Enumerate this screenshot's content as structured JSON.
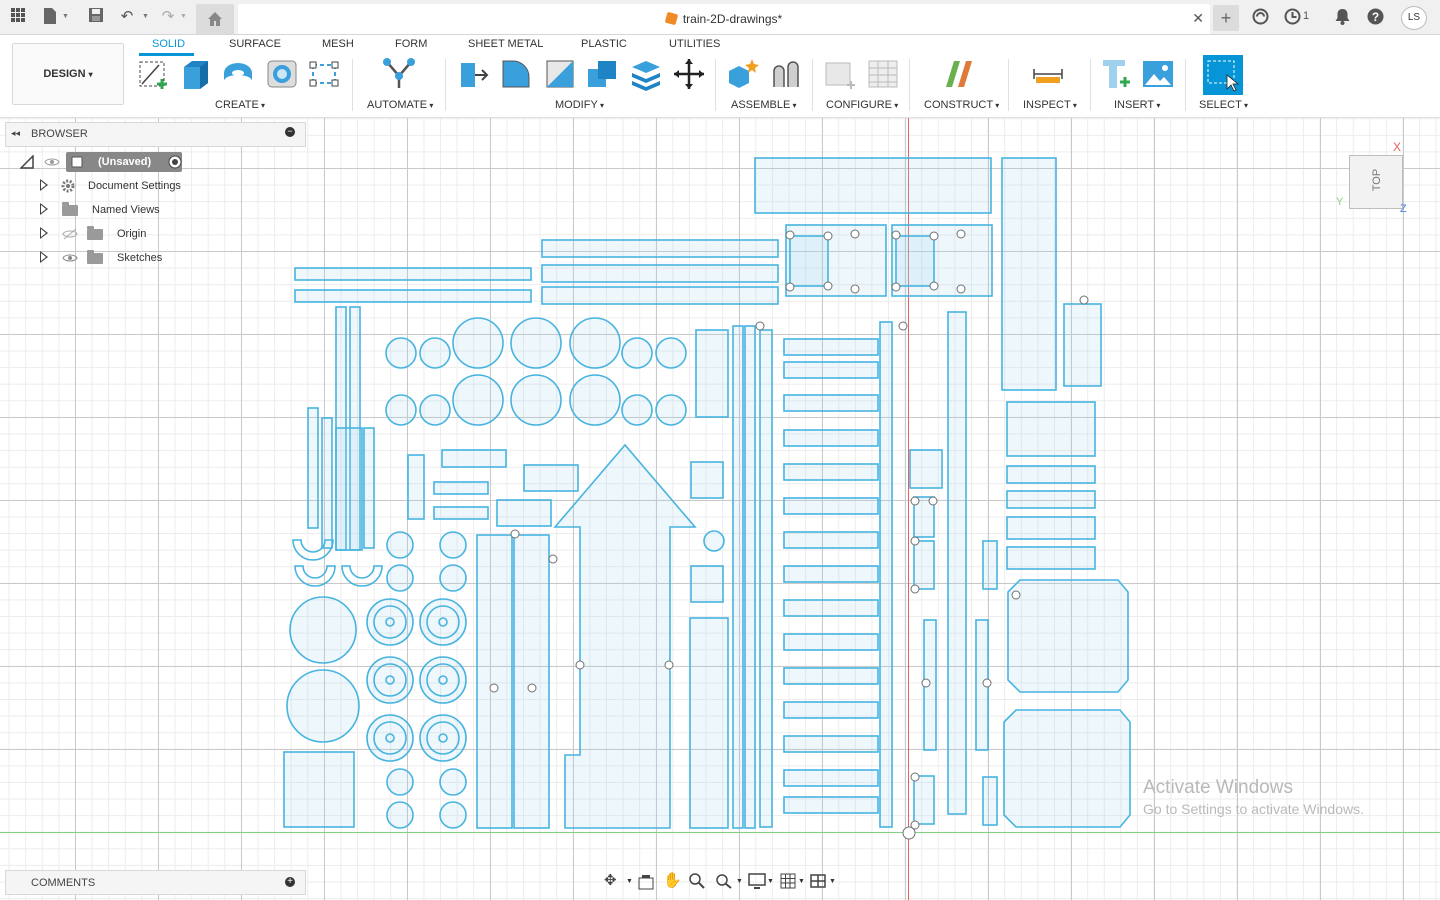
{
  "titlebar": {
    "document_title": "train-2D-drawings*",
    "job_count": "1",
    "user_initials": "LS"
  },
  "ribbon": {
    "tabs": [
      "SOLID",
      "SURFACE",
      "MESH",
      "FORM",
      "SHEET METAL",
      "PLASTIC",
      "UTILITIES"
    ],
    "active_tab": "SOLID",
    "workspace": "DESIGN",
    "groups": [
      "CREATE",
      "AUTOMATE",
      "MODIFY",
      "ASSEMBLE",
      "CONFIGURE",
      "CONSTRUCT",
      "INSPECT",
      "INSERT",
      "SELECT"
    ],
    "accent_color": "#0696d7"
  },
  "browser": {
    "header": "BROWSER",
    "root": "(Unsaved)",
    "items": [
      "Document Settings",
      "Named Views",
      "Origin",
      "Sketches"
    ]
  },
  "comments": {
    "label": "COMMENTS"
  },
  "viewcube": {
    "face": "TOP",
    "axis_x": "X",
    "axis_y": "Y",
    "axis_z": "Z"
  },
  "watermark": {
    "line1": "Activate Windows",
    "line2": "Go to Settings to activate Windows."
  },
  "colors": {
    "sketch_line": "#47b4e0",
    "x_axis": "#e86060",
    "y_axis": "#7fd07f"
  }
}
